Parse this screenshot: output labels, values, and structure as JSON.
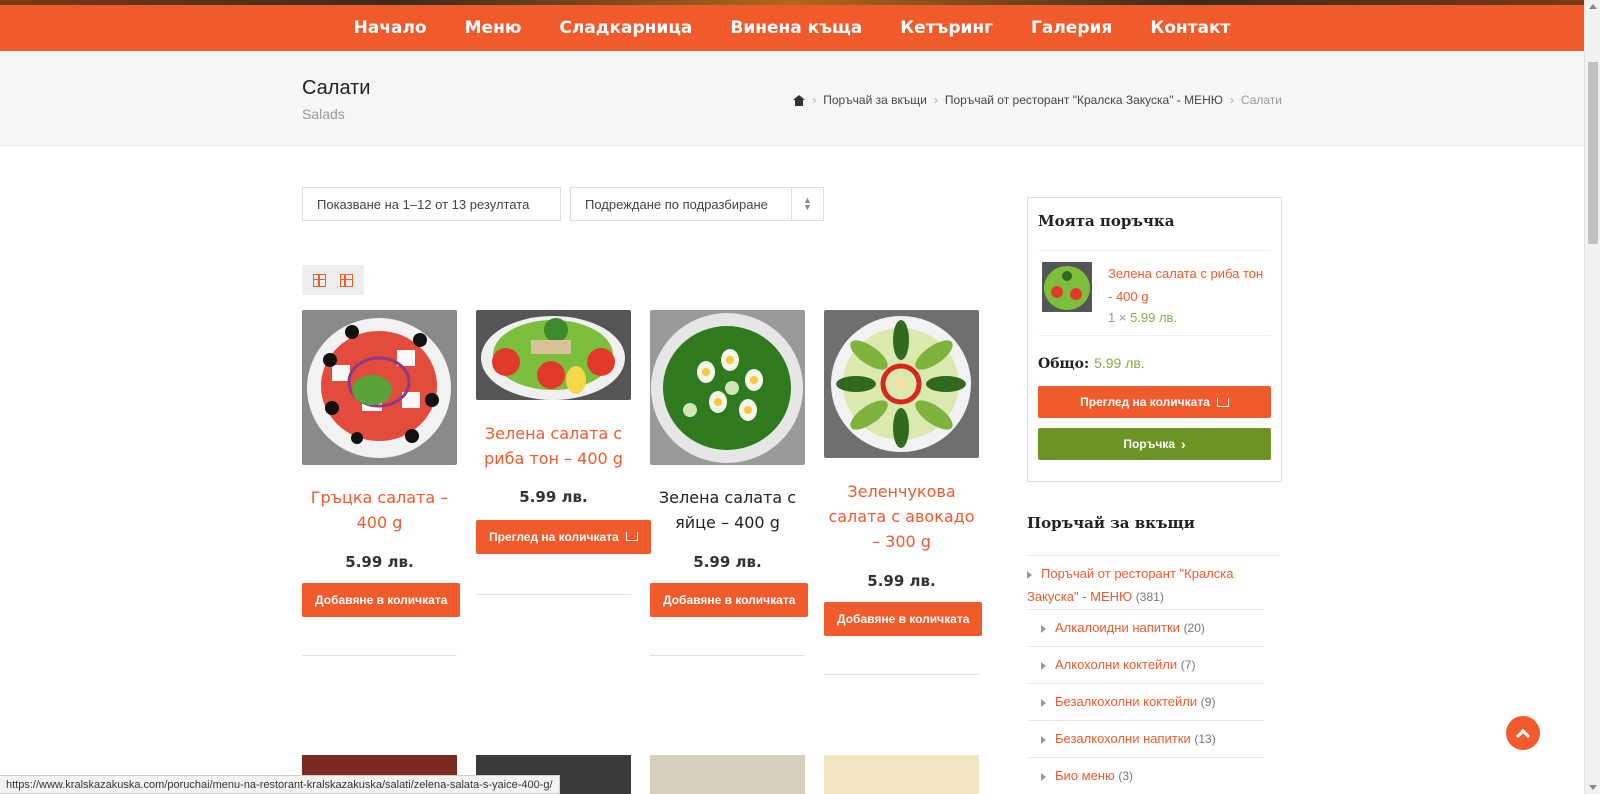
{
  "nav": {
    "items": [
      "Начало",
      "Меню",
      "Сладкарница",
      "Винена къща",
      "Кетъринг",
      "Галерия",
      "Контакт"
    ]
  },
  "page": {
    "title": "Салати",
    "subtitle": "Salads"
  },
  "breadcrumb": {
    "items": [
      "Поръчай за вкъщи",
      "Поръчай от ресторант \"Кралска Закуска\" - МЕНЮ"
    ],
    "current": "Салати"
  },
  "toolbar": {
    "result_count": "Показване на 1–12 от 13 резултата",
    "sort_selected": "Подреждане по подразбиране"
  },
  "products": [
    {
      "name": "Гръцка салата – 400 g",
      "price": "5.99 лв.",
      "button": "Добавяне в количката",
      "name_color": "#f15a2b"
    },
    {
      "name": "Зелена салата с риба тон – 400 g",
      "price": "5.99 лв.",
      "button": "Преглед на количката",
      "name_color": "#f15a2b"
    },
    {
      "name": "Зелена салата с яйце – 400 g",
      "price": "5.99 лв.",
      "button": "Добавяне в количката",
      "name_color": "#222222"
    },
    {
      "name": "Зеленчукова салата с авокадо – 300 g",
      "price": "5.99 лв.",
      "button": "Добавяне в количката",
      "name_color": "#f15a2b"
    }
  ],
  "cart": {
    "title": "Моята поръчка",
    "item_name": "Зелена салата с риба тон - 400 g",
    "item_qty": "1 ×",
    "item_price": "5.99 лв.",
    "total_label": "Общо:",
    "total_value": "5.99 лв.",
    "view_button": "Преглед на количката",
    "order_button": "Поръчка"
  },
  "categories": {
    "title": "Поръчай за вкъщи",
    "parent": {
      "name": "Поръчай от ресторант \"Кралска Закуска\" - МЕНЮ",
      "count": "(381)"
    },
    "items": [
      {
        "name": "Алкалоидни напитки",
        "count": "(20)"
      },
      {
        "name": "Алкохолни коктейли",
        "count": "(7)"
      },
      {
        "name": "Безалкохолни коктейли",
        "count": "(9)"
      },
      {
        "name": "Безалкохолни напитки",
        "count": "(13)"
      },
      {
        "name": "Био меню",
        "count": "(3)"
      }
    ]
  },
  "status_url": "https://www.kralskazakuska.com/poruchai/menu-na-restorant-kralskazakuska/salati/zelena-salata-s-yaice-400-g/",
  "colors": {
    "accent": "#f15a2b",
    "order_green": "#6b9425",
    "price_green": "#7cb342"
  }
}
